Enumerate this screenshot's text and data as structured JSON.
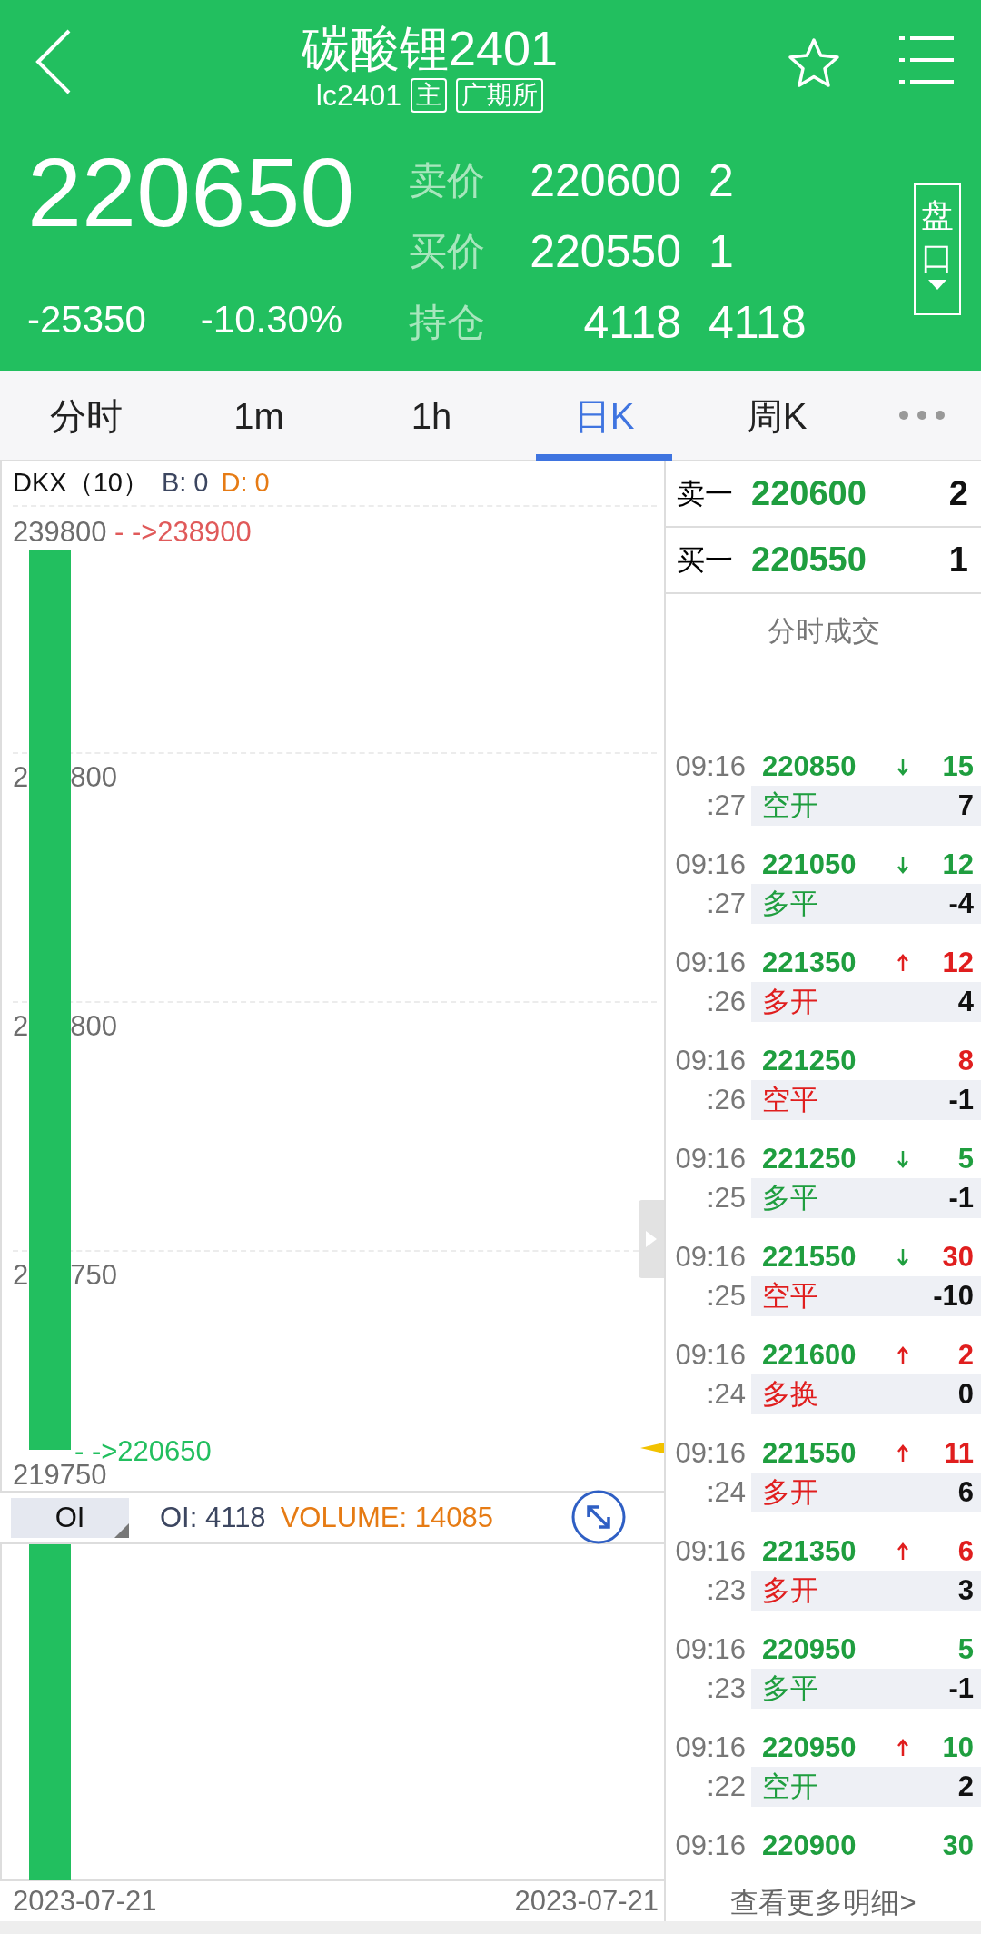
{
  "header": {
    "title": "碳酸锂2401",
    "code": "lc2401",
    "badges": [
      "主",
      "广期所"
    ],
    "price": "220650",
    "change": "-25350",
    "change_pct": "-10.30%",
    "quotes": [
      {
        "label": "卖价",
        "value": "220600",
        "qty": "2"
      },
      {
        "label": "买价",
        "value": "220550",
        "qty": "1"
      },
      {
        "label": "持仓",
        "value": "4118",
        "qty": "4118"
      }
    ],
    "side_button": "盘口"
  },
  "tabs": [
    {
      "label": "分时",
      "selected": false
    },
    {
      "label": "1m",
      "selected": false
    },
    {
      "label": "1h",
      "selected": false
    },
    {
      "label": "日K",
      "selected": true
    },
    {
      "label": "周K",
      "selected": false
    }
  ],
  "chart": {
    "indicator": "DKX（10）",
    "b_value": "B: 0",
    "d_value": "D: 0",
    "y_labels": [
      {
        "head": "239800"
      },
      {
        "head": "2",
        "tail": "800"
      },
      {
        "head": "2",
        "tail": "800"
      },
      {
        "head": "2",
        "tail": "750"
      },
      {
        "head": "219750"
      }
    ],
    "high_mark": "- ->238900",
    "last_mark": "- ->220650",
    "sub_selector": "OI",
    "oi": "OI: 4118",
    "volume": "VOLUME: 14085",
    "dates": [
      "2023-07-21",
      "2023-07-21"
    ]
  },
  "book": [
    {
      "label": "卖一",
      "price": "220600",
      "qty": "2"
    },
    {
      "label": "买一",
      "price": "220550",
      "qty": "1"
    }
  ],
  "trades_title": "分时成交",
  "trades": [
    {
      "time": "09:16",
      "sec": ":27",
      "price": "220850",
      "arrow_up": false,
      "arrow_down": true,
      "vol_buy": false,
      "vol": "15",
      "action": "空开",
      "action_buy": false,
      "diff": "7"
    },
    {
      "time": "09:16",
      "sec": ":27",
      "price": "221050",
      "arrow_up": false,
      "arrow_down": true,
      "vol_buy": false,
      "vol": "12",
      "action": "多平",
      "action_buy": false,
      "diff": "-4"
    },
    {
      "time": "09:16",
      "sec": ":26",
      "price": "221350",
      "arrow_up": true,
      "arrow_down": false,
      "vol_buy": true,
      "vol": "12",
      "action": "多开",
      "action_buy": true,
      "diff": "4"
    },
    {
      "time": "09:16",
      "sec": ":26",
      "price": "221250",
      "arrow_up": false,
      "arrow_down": false,
      "vol_buy": true,
      "vol": "8",
      "action": "空平",
      "action_buy": true,
      "diff": "-1"
    },
    {
      "time": "09:16",
      "sec": ":25",
      "price": "221250",
      "arrow_up": false,
      "arrow_down": true,
      "vol_buy": false,
      "vol": "5",
      "action": "多平",
      "action_buy": false,
      "diff": "-1"
    },
    {
      "time": "09:16",
      "sec": ":25",
      "price": "221550",
      "arrow_up": false,
      "arrow_down": true,
      "vol_buy": true,
      "vol": "30",
      "action": "空平",
      "action_buy": true,
      "diff": "-10"
    },
    {
      "time": "09:16",
      "sec": ":24",
      "price": "221600",
      "arrow_up": true,
      "arrow_down": false,
      "vol_buy": true,
      "vol": "2",
      "action": "多换",
      "action_buy": true,
      "diff": "0"
    },
    {
      "time": "09:16",
      "sec": ":24",
      "price": "221550",
      "arrow_up": true,
      "arrow_down": false,
      "vol_buy": true,
      "vol": "11",
      "action": "多开",
      "action_buy": true,
      "diff": "6"
    },
    {
      "time": "09:16",
      "sec": ":23",
      "price": "221350",
      "arrow_up": true,
      "arrow_down": false,
      "vol_buy": true,
      "vol": "6",
      "action": "多开",
      "action_buy": true,
      "diff": "3"
    },
    {
      "time": "09:16",
      "sec": ":23",
      "price": "220950",
      "arrow_up": false,
      "arrow_down": false,
      "vol_buy": false,
      "vol": "5",
      "action": "多平",
      "action_buy": false,
      "diff": "-1"
    },
    {
      "time": "09:16",
      "sec": ":22",
      "price": "220950",
      "arrow_up": true,
      "arrow_down": false,
      "vol_buy": false,
      "vol": "10",
      "action": "空开",
      "action_buy": false,
      "diff": "2"
    },
    {
      "time": "09:16",
      "price": "220900",
      "arrow_up": false,
      "arrow_down": false,
      "vol_buy": false,
      "vol": "30"
    }
  ],
  "more_link": "查看更多明细>"
}
